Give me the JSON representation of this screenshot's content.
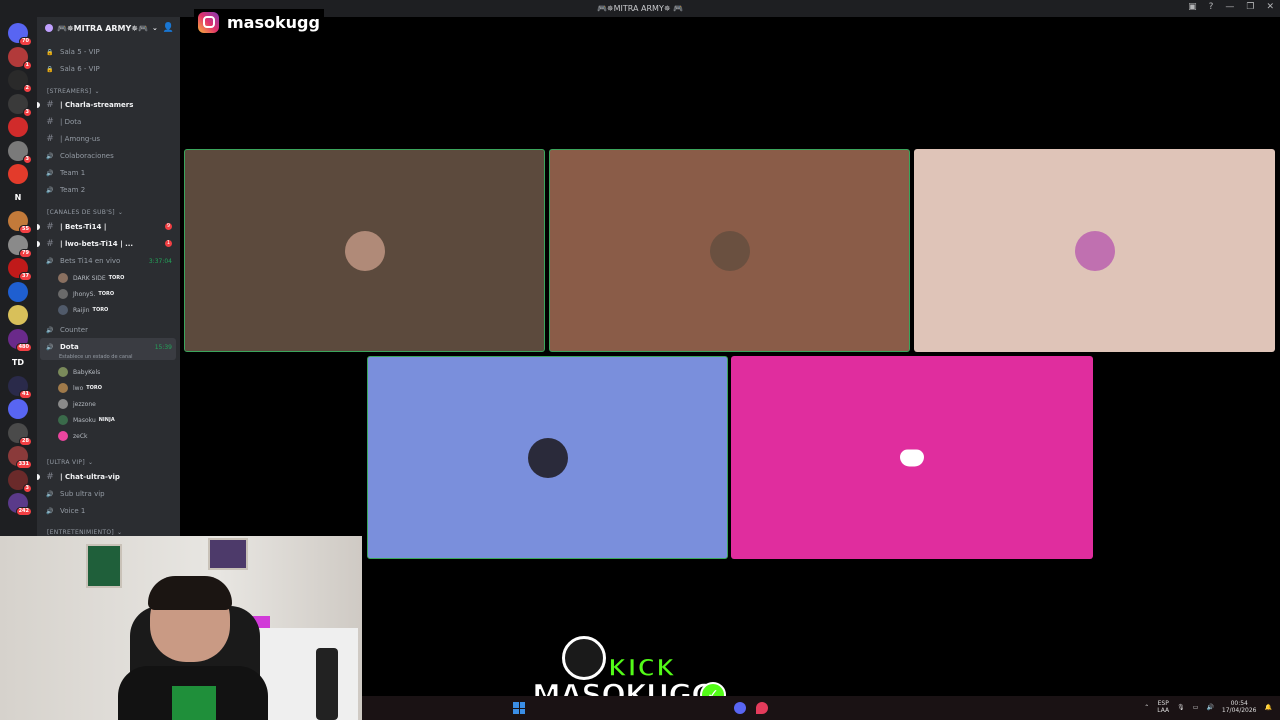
{
  "window": {
    "title": "🎮✵MITRA ARMY✵ 🎮",
    "controls": [
      "▣",
      "?",
      "—",
      "❐",
      "✕"
    ]
  },
  "overlay": {
    "instagram_handle": "masokugg"
  },
  "rail": {
    "servers": [
      {
        "label": "",
        "badge": "70",
        "color": "#5865f2"
      },
      {
        "label": "",
        "badge": "1",
        "color": "#b23a3a"
      },
      {
        "label": "",
        "badge": "2",
        "color": "#2a2a2a"
      },
      {
        "label": "",
        "badge": "3",
        "color": "#3a3a3a"
      },
      {
        "label": "",
        "badge": "",
        "color": "#d12b2b"
      },
      {
        "label": "",
        "badge": "3",
        "color": "#7a7a7a"
      },
      {
        "label": "",
        "badge": "",
        "color": "#e33b2b"
      },
      {
        "label": "N",
        "badge": "",
        "color": "#1e1f22"
      },
      {
        "label": "",
        "badge": "55",
        "color": "#c27a3a"
      },
      {
        "label": "",
        "badge": "79",
        "color": "#8a8a8a"
      },
      {
        "label": "",
        "badge": "37",
        "color": "#c01a1a"
      },
      {
        "label": "",
        "badge": "",
        "color": "#1f5fd0"
      },
      {
        "label": "",
        "badge": "",
        "color": "#d8c05a"
      },
      {
        "label": "",
        "badge": "480",
        "color": "#6a2a8a"
      },
      {
        "label": "TD",
        "badge": "",
        "color": "#1e1f22"
      },
      {
        "label": "",
        "badge": "41",
        "color": "#2a2a4a"
      },
      {
        "label": "",
        "badge": "",
        "color": "#5865f2"
      },
      {
        "label": "",
        "badge": "28",
        "color": "#4a4a4a"
      },
      {
        "label": "",
        "badge": "331",
        "color": "#8a3a3a"
      },
      {
        "label": "",
        "badge": "3",
        "color": "#6a2a2a"
      },
      {
        "label": "",
        "badge": "242",
        "color": "#5a3a8a"
      }
    ]
  },
  "sidebar": {
    "server_name": "🎮✵MITRA ARMY✵🎮",
    "rows": [
      {
        "type": "voice",
        "label": "Sala 5 - VIP",
        "locked": true
      },
      {
        "type": "voice",
        "label": "Sala 6 - VIP",
        "locked": true
      },
      {
        "type": "category",
        "label": "[STREAMERS]"
      },
      {
        "type": "text",
        "label": "| Charla-streamers",
        "bold": true
      },
      {
        "type": "text",
        "label": "| Dota"
      },
      {
        "type": "text",
        "label": "| Among-us"
      },
      {
        "type": "voice",
        "label": "Colaboraciones"
      },
      {
        "type": "voice",
        "label": "Team 1"
      },
      {
        "type": "voice",
        "label": "Team 2"
      },
      {
        "type": "category",
        "label": "[CANALES DE SUB'S]"
      },
      {
        "type": "text",
        "label": "| Bets-Ti14 |",
        "bold": true,
        "badge": "9"
      },
      {
        "type": "text",
        "label": "| lwo-bets-Ti14 | ...",
        "bold": true,
        "badge": "1"
      },
      {
        "type": "voice",
        "label": "Bets Ti14 en vivo",
        "timer": "3:37:04"
      },
      {
        "type": "voice",
        "label": "Counter"
      },
      {
        "type": "voice",
        "label": "Dota",
        "bold": true,
        "timer": "15:39",
        "status": "Establece un estado de canal"
      },
      {
        "type": "category",
        "label": "[ULTRA VIP]"
      },
      {
        "type": "text",
        "label": "| Chat-ultra-vip",
        "bold": true
      },
      {
        "type": "voice",
        "label": "Sub ultra vip"
      },
      {
        "type": "voice",
        "label": "Voice 1"
      },
      {
        "type": "category",
        "label": "[ENTRETENIMIENTO]"
      }
    ],
    "bets_users": [
      {
        "name": "DARK SIDE",
        "tag": "TORO",
        "color": "#8a7060"
      },
      {
        "name": "JhonyS.",
        "tag": "TORO",
        "color": "#6a6a6a"
      },
      {
        "name": "Raijin",
        "tag": "TORO",
        "color": "#505a6a"
      }
    ],
    "dota_users": [
      {
        "name": "BabyKels",
        "tag": "",
        "color": "#7a8a5a"
      },
      {
        "name": "lwo",
        "tag": "TORO",
        "color": "#a07a4a"
      },
      {
        "name": "jezzone",
        "tag": "",
        "color": "#8a8a8a"
      },
      {
        "name": "Masoku",
        "tag": "NINJA",
        "color": "#3a6a4a"
      },
      {
        "name": "zeCk",
        "tag": "",
        "color": "#eb459e"
      }
    ]
  },
  "tiles": [
    {
      "name": "tile-1",
      "bg": "#5c4a3d",
      "speaking": true,
      "pfp": "#b08a78"
    },
    {
      "name": "tile-2",
      "bg": "#8a5c48",
      "speaking": true,
      "pfp": "#6a5040"
    },
    {
      "name": "tile-3",
      "bg": "#dfc4b8",
      "speaking": false,
      "pfp": "#c070b0"
    },
    {
      "name": "tile-4",
      "bg": "#7a8fdc",
      "speaking": true,
      "pfp": "#2a2a3a"
    },
    {
      "name": "tile-5",
      "bg": "#e02d9e",
      "speaking": false,
      "pfp": "discord"
    }
  ],
  "branding": {
    "kick_label": "KICK",
    "channel_name": "MASOKUGG"
  },
  "taskbar": {
    "lang": "ESP",
    "layout": "LAA",
    "time": "00:54",
    "date": "17/04/2026"
  }
}
